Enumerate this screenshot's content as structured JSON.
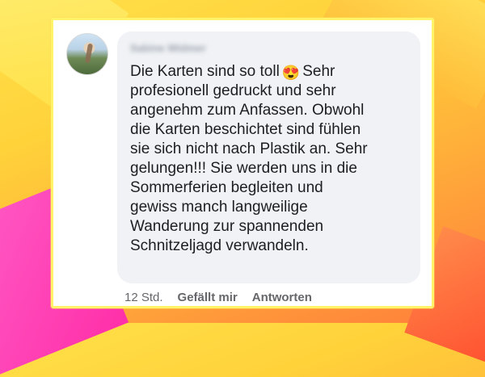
{
  "comment": {
    "author_name": "Sabine Widmer",
    "text_before_emoji": "Die Karten sind so toll",
    "emoji": "😍",
    "text_after_emoji": "Sehr\nprofesionell gedruckt und sehr\nangenehm zum Anfassen. Obwohl\ndie Karten beschichtet sind fühlen\nsie sich nicht nach Plastik an. Sehr\ngelungen!!!  Sie werden uns in die\nSommerferien begleiten und\ngewiss manch langweilige\nWanderung zur spannenden\nSchnitzeljagd verwandeln."
  },
  "actions": {
    "timestamp": "12 Std.",
    "like_label": "Gefällt mir",
    "reply_label": "Antworten"
  },
  "colors": {
    "bubble_bg": "#f0f2f5",
    "text": "#1c1e21",
    "meta_text": "#65676b",
    "frame_border": "#fff36a"
  },
  "icons": {
    "avatar": "profile-photo-avatar"
  }
}
